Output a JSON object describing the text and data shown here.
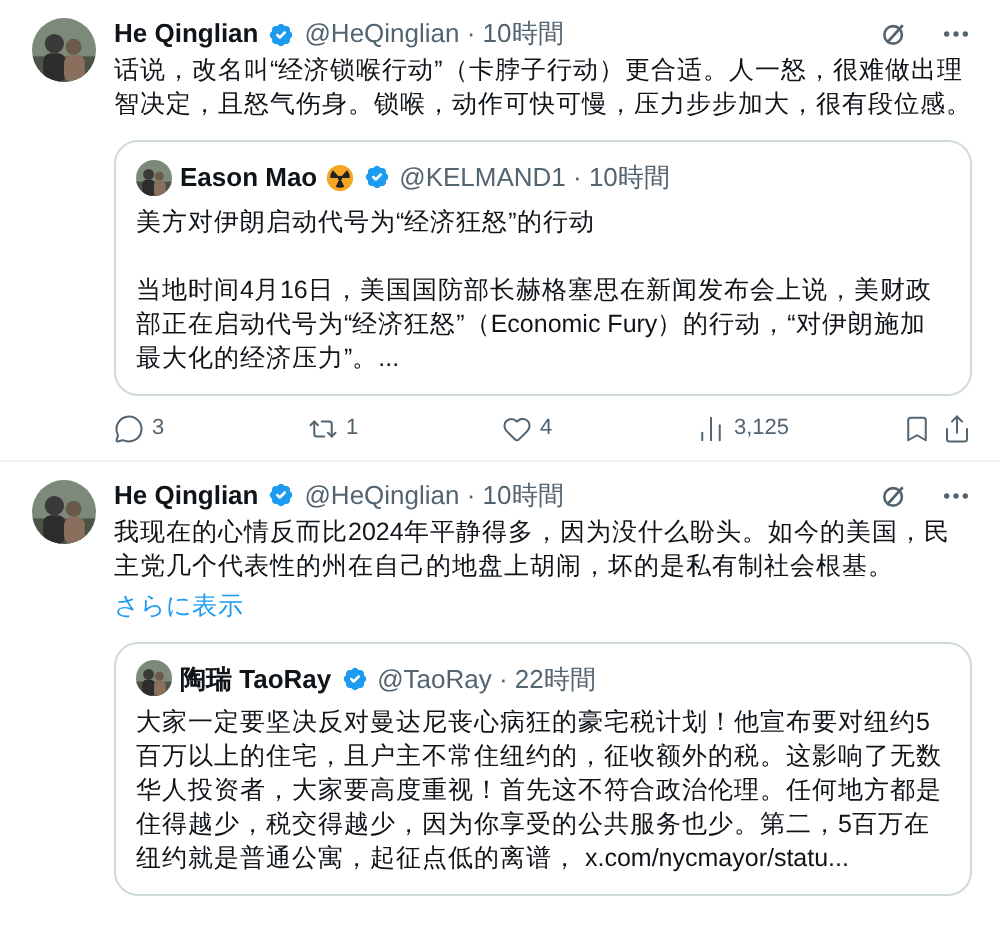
{
  "tweets": [
    {
      "author": "He Qinglian",
      "verified": true,
      "handle": "@HeQinglian · 10時間",
      "text": "话说，改名叫“经济锁喉行动”（卡脖子行动）更合适。人一怒，很难做出理智决定，且怒气伤身。锁喉，动作可快可慢，压力步步加大，很有段位感。",
      "quote": {
        "author": "Eason Mao",
        "emoji": true,
        "verified": true,
        "handle": "@KELMAND1 · 10時間",
        "paragraphs": [
          "美方对伊朗启动代号为“经济狂怒”的行动",
          "当地时间4月16日，美国国防部长赫格塞思在新闻发布会上说，美财政部正在启动代号为“经济狂怒”（Economic Fury）的行动，“对伊朗施加最大化的经济压力”。..."
        ]
      },
      "actions": [
        {
          "kind": "reply",
          "count": "3"
        },
        {
          "kind": "repost",
          "count": "1"
        },
        {
          "kind": "like",
          "count": "4"
        },
        {
          "kind": "views",
          "count": "3,125"
        },
        {
          "kind": "bookmark"
        },
        {
          "kind": "share"
        }
      ]
    },
    {
      "author": "He Qinglian",
      "verified": true,
      "handle": "@HeQinglian · 10時間",
      "text": "我现在的心情反而比2024年平静得多，因为没什么盼头。如今的美国，民主党几个代表性的州在自己的地盘上胡闹，坏的是私有制社会根基。",
      "show_more": "さらに表示",
      "quote": {
        "author": "陶瑞 TaoRay",
        "verified": true,
        "handle": "@TaoRay · 22時間",
        "paragraphs": [
          "大家一定要坚决反对曼达尼丧心病狂的豪宅税计划！他宣布要对纽约5百万以上的住宅，且户主不常住纽约的，征收额外的税。这影响了无数华人投资者，大家要高度重视！首先这不符合政治伦理。任何地方都是住得越少，税交得越少，因为你享受的公共服务也少。第二，5百万在纽约就是普通公寓，起征点低的离谱，"
        ],
        "link": "x.com/nycmayor/statu..."
      }
    }
  ]
}
